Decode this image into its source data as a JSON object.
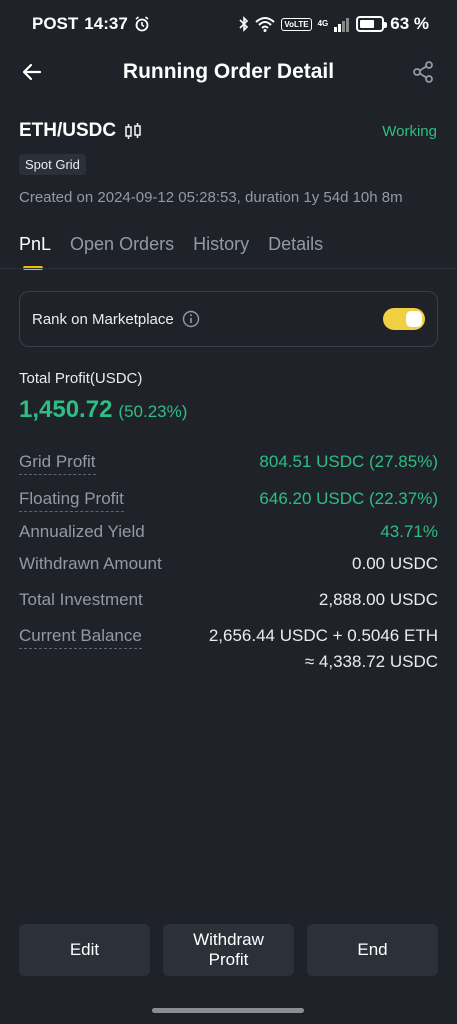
{
  "status_bar": {
    "carrier": "POST",
    "time": "14:37",
    "volte": "VoLTE",
    "network": "4G",
    "battery_text": "63 %",
    "battery_level": 0.63
  },
  "header": {
    "title": "Running Order Detail"
  },
  "order": {
    "pair": "ETH/USDC",
    "status": "Working",
    "strategy_tag": "Spot Grid",
    "created": "Created on 2024-09-12 05:28:53, duration 1y 54d 10h 8m"
  },
  "tabs": [
    {
      "label": "PnL",
      "active": true
    },
    {
      "label": "Open Orders",
      "active": false
    },
    {
      "label": "History",
      "active": false
    },
    {
      "label": "Details",
      "active": false
    }
  ],
  "rank": {
    "label": "Rank on Marketplace",
    "enabled": true
  },
  "total_profit": {
    "label": "Total Profit(USDC)",
    "value": "1,450.72",
    "percent": "(50.23%)"
  },
  "details": [
    {
      "label": "Grid Profit",
      "value": "804.51 USDC (27.85%)"
    },
    {
      "label": "Floating Profit",
      "value": "646.20 USDC (22.37%)"
    },
    {
      "label": "Annualized Yield",
      "value": "43.71%"
    },
    {
      "label": "Withdrawn Amount",
      "value": "0.00 USDC"
    },
    {
      "label": "Total Investment",
      "value": "2,888.00 USDC"
    },
    {
      "label": "Current Balance",
      "value": "2,656.44 USDC + 0.5046 ETH",
      "value2": "≈ 4,338.72 USDC"
    }
  ],
  "actions": {
    "edit": "Edit",
    "withdraw_line1": "Withdraw",
    "withdraw_line2": "Profit",
    "end": "End"
  },
  "colors": {
    "background": "#1f2329",
    "accent_green": "#2ebd85",
    "accent_yellow": "#f0b90b",
    "toggle_on": "#f0d040"
  }
}
